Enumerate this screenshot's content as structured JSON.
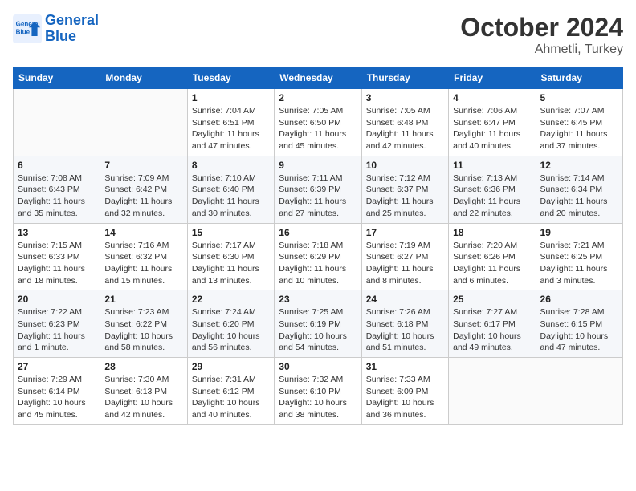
{
  "header": {
    "logo_line1": "General",
    "logo_line2": "Blue",
    "month": "October 2024",
    "location": "Ahmetli, Turkey"
  },
  "weekdays": [
    "Sunday",
    "Monday",
    "Tuesday",
    "Wednesday",
    "Thursday",
    "Friday",
    "Saturday"
  ],
  "weeks": [
    [
      {
        "day": "",
        "detail": ""
      },
      {
        "day": "",
        "detail": ""
      },
      {
        "day": "1",
        "detail": "Sunrise: 7:04 AM\nSunset: 6:51 PM\nDaylight: 11 hours and 47 minutes."
      },
      {
        "day": "2",
        "detail": "Sunrise: 7:05 AM\nSunset: 6:50 PM\nDaylight: 11 hours and 45 minutes."
      },
      {
        "day": "3",
        "detail": "Sunrise: 7:05 AM\nSunset: 6:48 PM\nDaylight: 11 hours and 42 minutes."
      },
      {
        "day": "4",
        "detail": "Sunrise: 7:06 AM\nSunset: 6:47 PM\nDaylight: 11 hours and 40 minutes."
      },
      {
        "day": "5",
        "detail": "Sunrise: 7:07 AM\nSunset: 6:45 PM\nDaylight: 11 hours and 37 minutes."
      }
    ],
    [
      {
        "day": "6",
        "detail": "Sunrise: 7:08 AM\nSunset: 6:43 PM\nDaylight: 11 hours and 35 minutes."
      },
      {
        "day": "7",
        "detail": "Sunrise: 7:09 AM\nSunset: 6:42 PM\nDaylight: 11 hours and 32 minutes."
      },
      {
        "day": "8",
        "detail": "Sunrise: 7:10 AM\nSunset: 6:40 PM\nDaylight: 11 hours and 30 minutes."
      },
      {
        "day": "9",
        "detail": "Sunrise: 7:11 AM\nSunset: 6:39 PM\nDaylight: 11 hours and 27 minutes."
      },
      {
        "day": "10",
        "detail": "Sunrise: 7:12 AM\nSunset: 6:37 PM\nDaylight: 11 hours and 25 minutes."
      },
      {
        "day": "11",
        "detail": "Sunrise: 7:13 AM\nSunset: 6:36 PM\nDaylight: 11 hours and 22 minutes."
      },
      {
        "day": "12",
        "detail": "Sunrise: 7:14 AM\nSunset: 6:34 PM\nDaylight: 11 hours and 20 minutes."
      }
    ],
    [
      {
        "day": "13",
        "detail": "Sunrise: 7:15 AM\nSunset: 6:33 PM\nDaylight: 11 hours and 18 minutes."
      },
      {
        "day": "14",
        "detail": "Sunrise: 7:16 AM\nSunset: 6:32 PM\nDaylight: 11 hours and 15 minutes."
      },
      {
        "day": "15",
        "detail": "Sunrise: 7:17 AM\nSunset: 6:30 PM\nDaylight: 11 hours and 13 minutes."
      },
      {
        "day": "16",
        "detail": "Sunrise: 7:18 AM\nSunset: 6:29 PM\nDaylight: 11 hours and 10 minutes."
      },
      {
        "day": "17",
        "detail": "Sunrise: 7:19 AM\nSunset: 6:27 PM\nDaylight: 11 hours and 8 minutes."
      },
      {
        "day": "18",
        "detail": "Sunrise: 7:20 AM\nSunset: 6:26 PM\nDaylight: 11 hours and 6 minutes."
      },
      {
        "day": "19",
        "detail": "Sunrise: 7:21 AM\nSunset: 6:25 PM\nDaylight: 11 hours and 3 minutes."
      }
    ],
    [
      {
        "day": "20",
        "detail": "Sunrise: 7:22 AM\nSunset: 6:23 PM\nDaylight: 11 hours and 1 minute."
      },
      {
        "day": "21",
        "detail": "Sunrise: 7:23 AM\nSunset: 6:22 PM\nDaylight: 10 hours and 58 minutes."
      },
      {
        "day": "22",
        "detail": "Sunrise: 7:24 AM\nSunset: 6:20 PM\nDaylight: 10 hours and 56 minutes."
      },
      {
        "day": "23",
        "detail": "Sunrise: 7:25 AM\nSunset: 6:19 PM\nDaylight: 10 hours and 54 minutes."
      },
      {
        "day": "24",
        "detail": "Sunrise: 7:26 AM\nSunset: 6:18 PM\nDaylight: 10 hours and 51 minutes."
      },
      {
        "day": "25",
        "detail": "Sunrise: 7:27 AM\nSunset: 6:17 PM\nDaylight: 10 hours and 49 minutes."
      },
      {
        "day": "26",
        "detail": "Sunrise: 7:28 AM\nSunset: 6:15 PM\nDaylight: 10 hours and 47 minutes."
      }
    ],
    [
      {
        "day": "27",
        "detail": "Sunrise: 7:29 AM\nSunset: 6:14 PM\nDaylight: 10 hours and 45 minutes."
      },
      {
        "day": "28",
        "detail": "Sunrise: 7:30 AM\nSunset: 6:13 PM\nDaylight: 10 hours and 42 minutes."
      },
      {
        "day": "29",
        "detail": "Sunrise: 7:31 AM\nSunset: 6:12 PM\nDaylight: 10 hours and 40 minutes."
      },
      {
        "day": "30",
        "detail": "Sunrise: 7:32 AM\nSunset: 6:10 PM\nDaylight: 10 hours and 38 minutes."
      },
      {
        "day": "31",
        "detail": "Sunrise: 7:33 AM\nSunset: 6:09 PM\nDaylight: 10 hours and 36 minutes."
      },
      {
        "day": "",
        "detail": ""
      },
      {
        "day": "",
        "detail": ""
      }
    ]
  ]
}
